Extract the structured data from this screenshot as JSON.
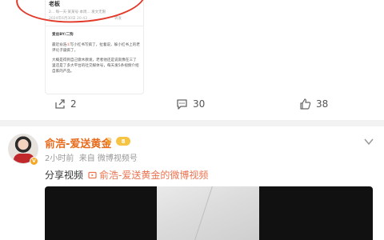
{
  "prev_card": {
    "title": "老板",
    "meta": "2... 每一天·某某号·本周...  发文无限",
    "meta2": "2024年6月30日 20:43  ...",
    "share_text": "转发",
    "author_line": "爱丝BY/二狗",
    "para1_a": "最近俞浩",
    "para1_b": "写小红书写疯了，拉着说，躲小红书上的老评论子逼疯了。",
    "para2": "大概是得到自己傲木教发，老者他还是说就像在三了里还是了多大平台的社交媒体号，每天发5条视频介绍自家的产品。"
  },
  "actions": {
    "repost_count": "2",
    "comment_count": "30",
    "like_count": "38"
  },
  "post": {
    "username": "俞浩-爱送黄金",
    "level": "8",
    "time": "2小时前",
    "source": "来自 微博视频号",
    "share_label": "分享视频",
    "link_text": "俞浩-爱送黄金的微博视频"
  },
  "colors": {
    "accent": "#eb7350",
    "username": "#e86a1a",
    "annotation_oval": "#e23a2a"
  }
}
